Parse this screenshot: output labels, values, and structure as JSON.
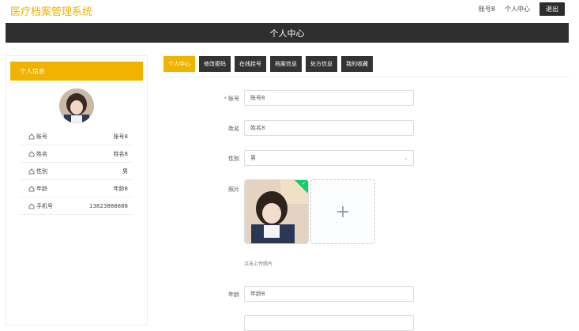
{
  "header": {
    "brand": "医疗档案管理系统",
    "account": "账号8",
    "profile_link": "个人中心",
    "logout": "退出"
  },
  "page_title": "个人中心",
  "sidebar": {
    "title": "个人信息",
    "rows": [
      {
        "label": "账号",
        "value": "账号8"
      },
      {
        "label": "姓名",
        "value": "姓名8"
      },
      {
        "label": "性别",
        "value": "男"
      },
      {
        "label": "年龄",
        "value": "年龄8"
      },
      {
        "label": "手机号",
        "value": "13823888888"
      }
    ]
  },
  "tabs": [
    "个人中心",
    "修改密码",
    "在线挂号",
    "档案信息",
    "处方信息",
    "我的收藏"
  ],
  "form": {
    "account_label": "账号",
    "account_value": "账号8",
    "name_label": "姓名",
    "name_value": "姓名8",
    "gender_label": "性别",
    "gender_value": "男",
    "photo_label": "照片",
    "photo_hint": "点击上传照片",
    "upload_plus": "+",
    "age_label": "年龄",
    "age_value": "年龄8"
  },
  "colors": {
    "accent": "#f0b400",
    "dark": "#2f2f2f",
    "success": "#13ce66"
  }
}
